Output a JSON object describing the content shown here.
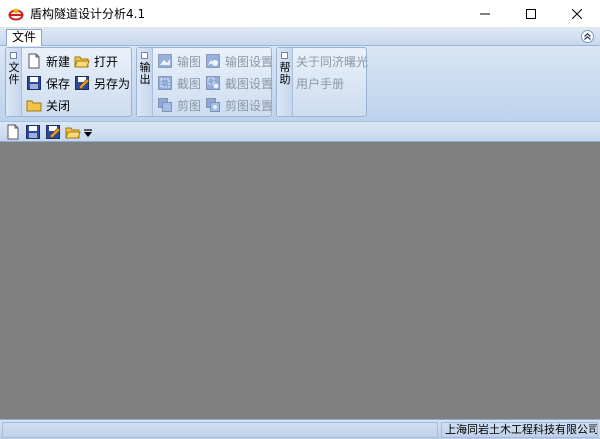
{
  "window": {
    "title": "盾构隧道设计分析4.1"
  },
  "ribbon": {
    "tabs": [
      {
        "label": "文件"
      }
    ],
    "groups": {
      "file": {
        "caption": "文件",
        "new": "新建",
        "open": "打开",
        "save": "保存",
        "save_as": "另存为",
        "close": "关闭"
      },
      "output": {
        "caption": "输出",
        "export_image": "输图",
        "export_image_settings": "输图设置",
        "capture": "截图",
        "capture_settings": "截图设置",
        "cut": "剪图",
        "cut_settings": "剪图设置"
      },
      "help": {
        "caption": "帮助",
        "about": "关于同济曙光",
        "manual": "用户手册"
      }
    }
  },
  "statusbar": {
    "company": "上海同岩土木工程科技有限公司"
  },
  "colors": {
    "workspace": "#808080",
    "ribbon_bg": "#c9dbf0",
    "title_bg": "#ffffff"
  }
}
